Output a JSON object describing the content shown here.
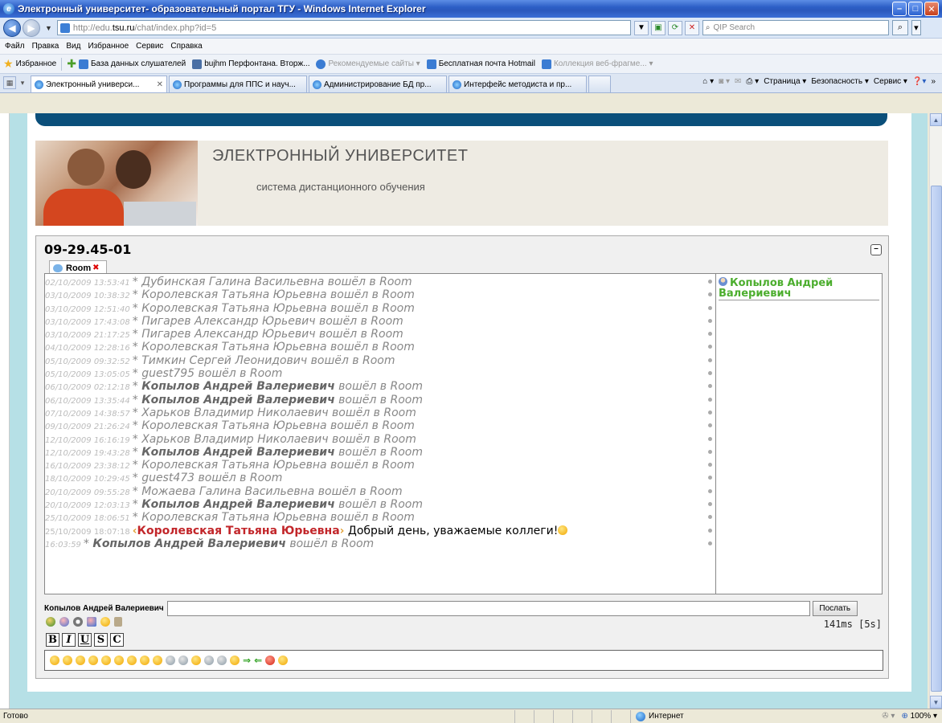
{
  "window": {
    "title": "Электронный университет- образовательный портал ТГУ - Windows Internet Explorer"
  },
  "address": {
    "url_prefix": "http://edu.",
    "url_domain": "tsu.ru",
    "url_path": "/chat/index.php?id=5",
    "search_placeholder": "QIP Search"
  },
  "menu": [
    "Файл",
    "Правка",
    "Вид",
    "Избранное",
    "Сервис",
    "Справка"
  ],
  "favorites": {
    "label": "Избранное",
    "items": [
      {
        "label": "База данных слушателей",
        "dim": false
      },
      {
        "label": "bujhm Перфонтана. Вторж...",
        "dim": false
      },
      {
        "label": "Рекомендуемые сайты ▾",
        "dim": true
      },
      {
        "label": "Бесплатная почта Hotmail",
        "dim": false
      },
      {
        "label": "Коллекция веб-фрагме... ▾",
        "dim": true
      }
    ]
  },
  "tabs": [
    {
      "label": "Электронный универси...",
      "active": true
    },
    {
      "label": "Программы для ППС и науч...",
      "active": false
    },
    {
      "label": "Администрирование БД пр...",
      "active": false
    },
    {
      "label": "Интерфейс методиста и пр...",
      "active": false
    }
  ],
  "command_bar": [
    "Страница ▾",
    "Безопасность ▾",
    "Сервис ▾"
  ],
  "banner": {
    "title": "ЭЛЕКТРОННЫЙ УНИВЕРСИТЕТ",
    "subtitle": "система дистанционного обучения"
  },
  "chat": {
    "room_id": "09-29.45-01",
    "room_tab": "Room",
    "messages": [
      {
        "ts": "02/10/2009 13:53:41",
        "name": "Дубинская Галина Васильевна",
        "action": "вошёл в Room",
        "bold": false
      },
      {
        "ts": "03/10/2009 10:38:32",
        "name": "Королевская Татьяна Юрьевна",
        "action": "вошёл в Room",
        "bold": false
      },
      {
        "ts": "03/10/2009 12:51:40",
        "name": "Королевская Татьяна Юрьевна",
        "action": "вошёл в Room",
        "bold": false
      },
      {
        "ts": "03/10/2009 17:43:08",
        "name": "Пигарев Александр Юрьевич",
        "action": "вошёл в Room",
        "bold": false
      },
      {
        "ts": "03/10/2009 21:17:25",
        "name": "Пигарев Александр Юрьевич",
        "action": "вошёл в Room",
        "bold": false
      },
      {
        "ts": "04/10/2009 12:28:16",
        "name": "Королевская Татьяна Юрьевна",
        "action": "вошёл в Room",
        "bold": false
      },
      {
        "ts": "05/10/2009 09:32:52",
        "name": "Тимкин Сергей Леонидович",
        "action": "вошёл в Room",
        "bold": false
      },
      {
        "ts": "05/10/2009 13:05:05",
        "name": "guest795",
        "action": "вошёл в Room",
        "bold": false
      },
      {
        "ts": "06/10/2009 02:12:18",
        "name": "Копылов Андрей Валериевич",
        "action": "вошёл в Room",
        "bold": true
      },
      {
        "ts": "06/10/2009 13:35:44",
        "name": "Копылов Андрей Валериевич",
        "action": "вошёл в Room",
        "bold": true
      },
      {
        "ts": "07/10/2009 14:38:57",
        "name": "Харьков Владимир Николаевич",
        "action": "вошёл в Room",
        "bold": false
      },
      {
        "ts": "09/10/2009 21:26:24",
        "name": "Королевская Татьяна Юрьевна",
        "action": "вошёл в Room",
        "bold": false
      },
      {
        "ts": "12/10/2009 16:16:19",
        "name": "Харьков Владимир Николаевич",
        "action": "вошёл в Room",
        "bold": false
      },
      {
        "ts": "12/10/2009 19:43:28",
        "name": "Копылов Андрей Валериевич",
        "action": "вошёл в Room",
        "bold": true
      },
      {
        "ts": "16/10/2009 23:38:12",
        "name": "Королевская Татьяна Юрьевна",
        "action": "вошёл в Room",
        "bold": false
      },
      {
        "ts": "18/10/2009 10:29:45",
        "name": "guest473",
        "action": "вошёл в Room",
        "bold": false
      },
      {
        "ts": "20/10/2009 09:55:28",
        "name": "Можаева Галина Васильевна",
        "action": "вошёл в Room",
        "bold": false
      },
      {
        "ts": "20/10/2009 12:03:13",
        "name": "Копылов Андрей Валериевич",
        "action": "вошёл в Room",
        "bold": true
      },
      {
        "ts": "25/10/2009 18:06:51",
        "name": "Королевская Татьяна Юрьевна",
        "action": "вошёл в Room",
        "bold": false
      }
    ],
    "say_message": {
      "ts": "25/10/2009 18:07:18",
      "speaker": "Королевская Татьяна Юрьевна",
      "text": "Добрый день, уважаемые коллеги!"
    },
    "last_message": {
      "ts": "16:03:59",
      "name": "Копылов Андрей Валериевич",
      "action": "вошёл в Room"
    },
    "user_list": [
      "Копылов Андрей Валериевич"
    ],
    "input_nick": "Копылов Андрей Валериевич",
    "send_label": "Послать",
    "timing": "141ms [5s]",
    "format_buttons": [
      "B",
      "I",
      "U",
      "S",
      "C"
    ]
  },
  "status": {
    "text": "Готово",
    "zone": "Интернет",
    "zoom": "100%"
  }
}
